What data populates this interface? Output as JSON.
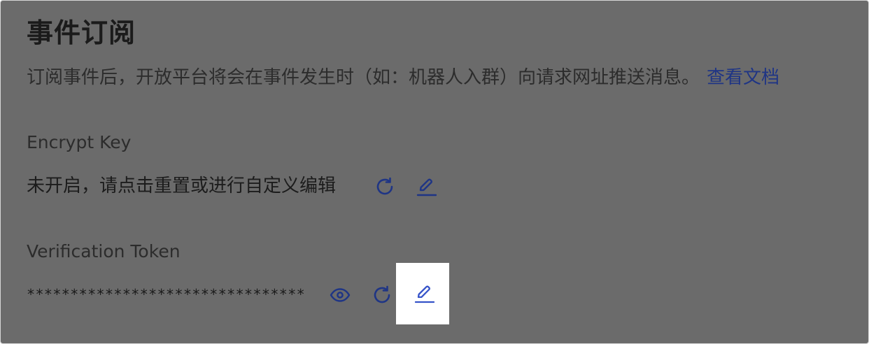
{
  "section": {
    "title": "事件订阅",
    "description": "订阅事件后，开放平台将会在事件发生时（如：机器人入群）向请求网址推送消息。",
    "doc_link": "查看文档"
  },
  "encrypt_key": {
    "label": "Encrypt Key",
    "status": "未开启，请点击重置或进行自定义编辑",
    "actions": [
      "refresh-icon",
      "edit-icon"
    ]
  },
  "verification_token": {
    "label": "Verification Token",
    "masked_value": "********************************",
    "actions": [
      "eye-icon",
      "refresh-icon",
      "edit-icon"
    ]
  },
  "colors": {
    "overlay": "#6b6b6b",
    "icon_dim": "#1f3585",
    "icon_active": "#3553c9",
    "link": "#1f3585"
  }
}
